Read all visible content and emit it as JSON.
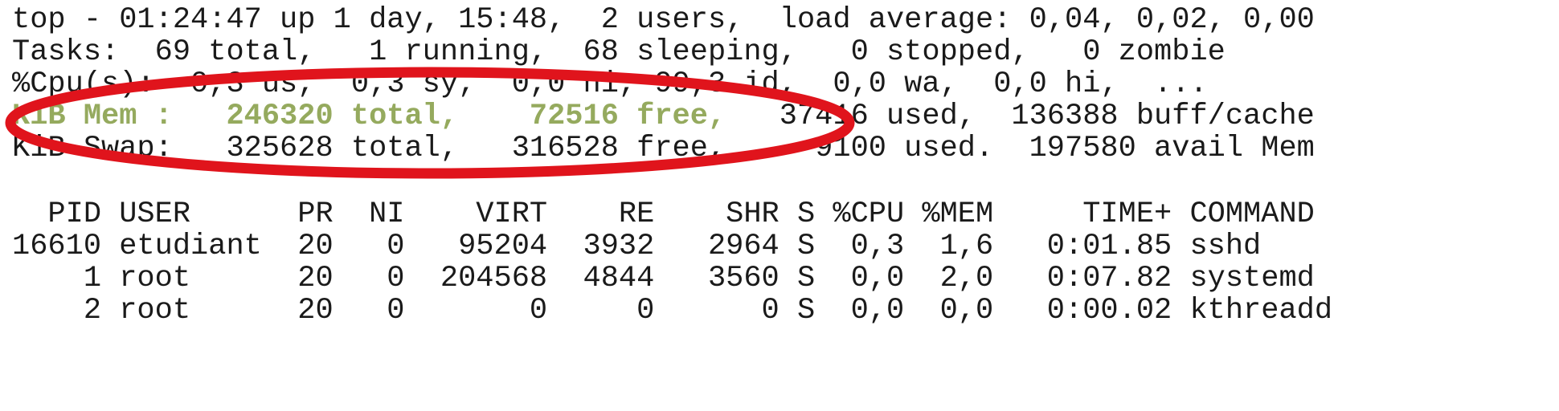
{
  "summary": {
    "uptime_line": "top - 01:24:47 up 1 day, 15:48,  2 users,  load average: 0,04, 0,02, 0,00",
    "tasks_line": "Tasks:  69 total,   1 running,  68 sleeping,   0 stopped,   0 zombie",
    "cpu_line": "%Cpu(s):  0,3 us,  0,3 sy,  0,0 ni, 99,3 id,  0,0 wa,  0,0 hi,  ...",
    "mem_highlight": "KiB Mem :   246320 total,    72516 free,",
    "mem_rest": "   37416 used,  136388 buff/cache",
    "swap_line": "KiB Swap:   325628 total,   316528 free,     9100 used.  197580 avail Mem"
  },
  "process_table": {
    "header": "  PID USER      PR  NI    VIRT    RE    SHR S %CPU %MEM     TIME+ COMMAND",
    "rows": [
      "16610 etudiant  20   0   95204  3932   2964 S  0,3  1,6   0:01.85 sshd",
      "    1 root      20   0  204568  4844   3560 S  0,0  2,0   0:07.82 systemd",
      "    2 root      20   0       0     0      0 S  0,0  0,0   0:00.02 kthreadd"
    ]
  },
  "colors": {
    "text": "#1a1a1a",
    "highlight": "#95aa5e",
    "annotation": "#e0141c"
  }
}
